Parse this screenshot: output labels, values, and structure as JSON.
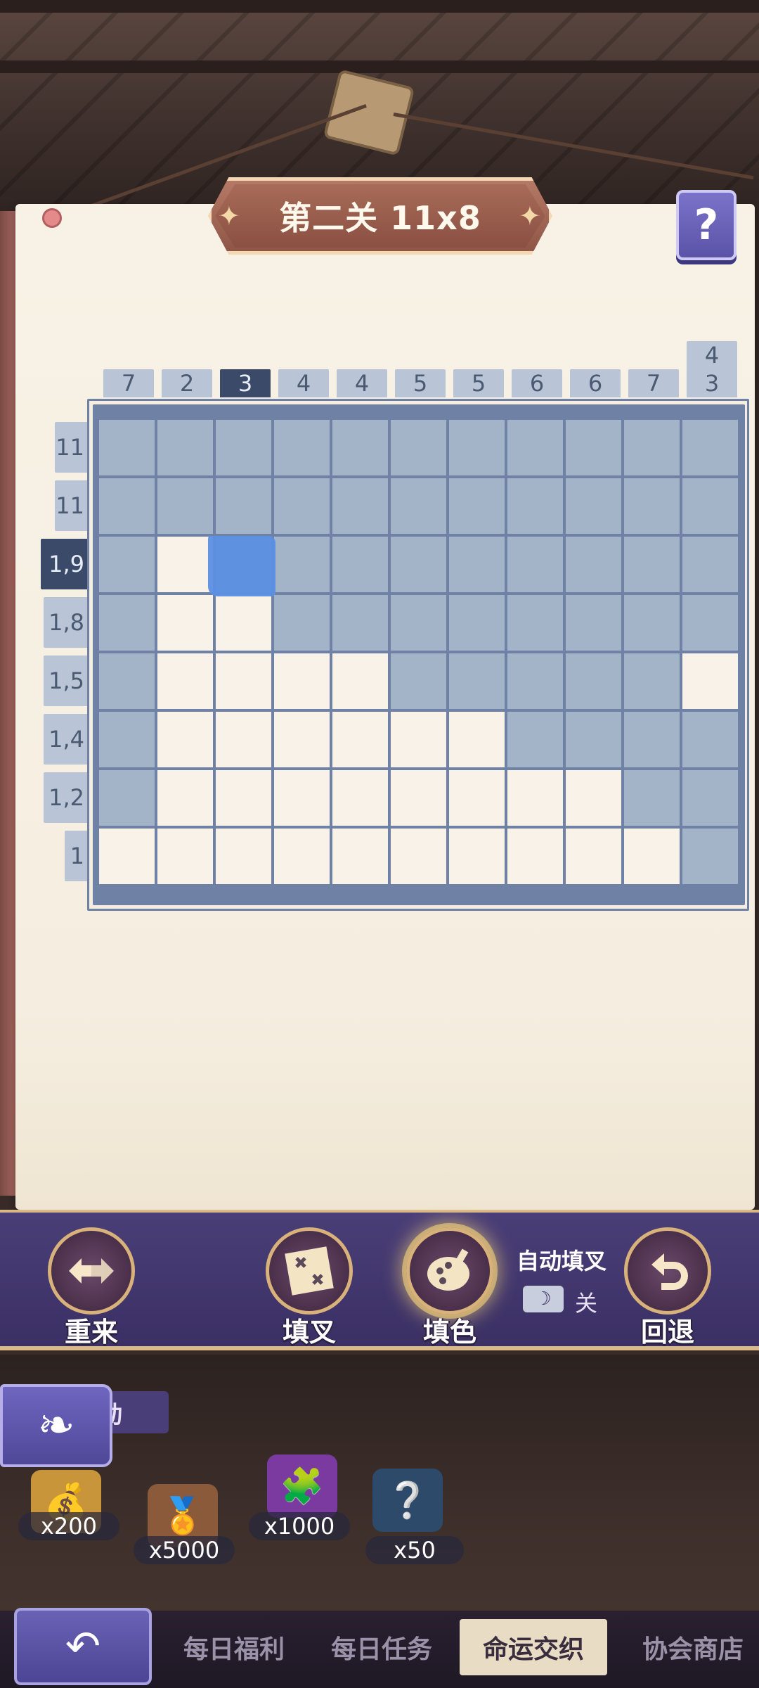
{
  "level_title": "第二关 11x8",
  "help_label": "?",
  "column_clues": [
    {
      "lines": [
        "7"
      ],
      "active": false
    },
    {
      "lines": [
        "2"
      ],
      "active": false
    },
    {
      "lines": [
        "3"
      ],
      "active": true
    },
    {
      "lines": [
        "4"
      ],
      "active": false
    },
    {
      "lines": [
        "4"
      ],
      "active": false
    },
    {
      "lines": [
        "5"
      ],
      "active": false
    },
    {
      "lines": [
        "5"
      ],
      "active": false
    },
    {
      "lines": [
        "6"
      ],
      "active": false
    },
    {
      "lines": [
        "6"
      ],
      "active": false
    },
    {
      "lines": [
        "7"
      ],
      "active": false
    },
    {
      "lines": [
        "4",
        "3"
      ],
      "active": false
    }
  ],
  "row_clues": [
    {
      "text": "11",
      "active": false
    },
    {
      "text": "11",
      "active": false
    },
    {
      "text": "1,9",
      "active": true
    },
    {
      "text": "1,8",
      "active": false
    },
    {
      "text": "1,5",
      "active": false
    },
    {
      "text": "1,4",
      "active": false
    },
    {
      "text": "1,2",
      "active": false
    },
    {
      "text": "1",
      "active": false
    }
  ],
  "grid": [
    [
      1,
      1,
      1,
      1,
      1,
      1,
      1,
      1,
      1,
      1,
      1
    ],
    [
      1,
      1,
      1,
      1,
      1,
      1,
      1,
      1,
      1,
      1,
      1
    ],
    [
      1,
      0,
      1,
      1,
      1,
      1,
      1,
      1,
      1,
      1,
      1
    ],
    [
      1,
      0,
      0,
      1,
      1,
      1,
      1,
      1,
      1,
      1,
      1
    ],
    [
      1,
      0,
      0,
      0,
      0,
      1,
      1,
      1,
      1,
      1,
      0
    ],
    [
      1,
      0,
      0,
      0,
      0,
      0,
      0,
      1,
      1,
      1,
      1
    ],
    [
      1,
      0,
      0,
      0,
      0,
      0,
      0,
      0,
      0,
      1,
      1
    ],
    [
      0,
      0,
      0,
      0,
      0,
      0,
      0,
      0,
      0,
      0,
      1
    ]
  ],
  "colors": {
    "filled_cell": "#a3b3c8",
    "empty_cell": "#f8f2e8",
    "grid_line": "#6f82a6",
    "active_clue": "#3a4a68",
    "cursor": "#5b8fe2"
  },
  "toolbar": {
    "restart_label": "重来",
    "cross_label": "填叉",
    "fill_label": "填色",
    "auto_cross_label": "自动填叉",
    "auto_cross_state": "关",
    "undo_label": "回退"
  },
  "rewards": {
    "tab_label": "动",
    "items": [
      {
        "icon": "coin-bag-icon",
        "qty": "x200"
      },
      {
        "icon": "badge-icon",
        "qty": "x5000"
      },
      {
        "icon": "puzzle-piece-icon",
        "qty": "x1000"
      },
      {
        "icon": "mystery-card-icon",
        "qty": "x50"
      }
    ]
  },
  "bottom_nav": [
    {
      "label": "每日福利",
      "active": false
    },
    {
      "label": "每日任务",
      "active": false
    },
    {
      "label": "命运交织",
      "active": true
    },
    {
      "label": "协会商店",
      "active": false
    }
  ]
}
